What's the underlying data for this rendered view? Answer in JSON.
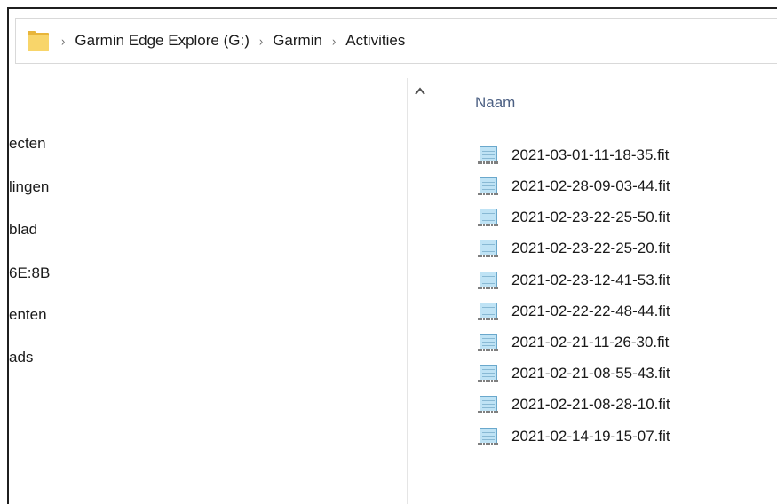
{
  "breadcrumb": {
    "items": [
      {
        "label": "Garmin Edge Explore (G:)"
      },
      {
        "label": "Garmin"
      },
      {
        "label": "Activities"
      }
    ],
    "separator": "›"
  },
  "nav": {
    "items": [
      {
        "label": "ecten"
      },
      {
        "label": "lingen"
      },
      {
        "label": "blad"
      },
      {
        "label": "6E:8B"
      },
      {
        "label": "enten"
      },
      {
        "label": "ads"
      }
    ]
  },
  "files": {
    "column_header": "Naam",
    "rows": [
      {
        "name": "2021-03-01-11-18-35.fit"
      },
      {
        "name": "2021-02-28-09-03-44.fit"
      },
      {
        "name": "2021-02-23-22-25-50.fit"
      },
      {
        "name": "2021-02-23-22-25-20.fit"
      },
      {
        "name": "2021-02-23-12-41-53.fit"
      },
      {
        "name": "2021-02-22-22-48-44.fit"
      },
      {
        "name": "2021-02-21-11-26-30.fit"
      },
      {
        "name": "2021-02-21-08-55-43.fit"
      },
      {
        "name": "2021-02-21-08-28-10.fit"
      },
      {
        "name": "2021-02-14-19-15-07.fit"
      }
    ]
  },
  "colors": {
    "folder": "#f8d56a",
    "header_text": "#4c6083",
    "file_icon": "#bfe3f5"
  },
  "icons": {
    "address_folder": "folder-icon",
    "scroll_up": "chevron-up-icon",
    "file": "fit-file-icon"
  }
}
